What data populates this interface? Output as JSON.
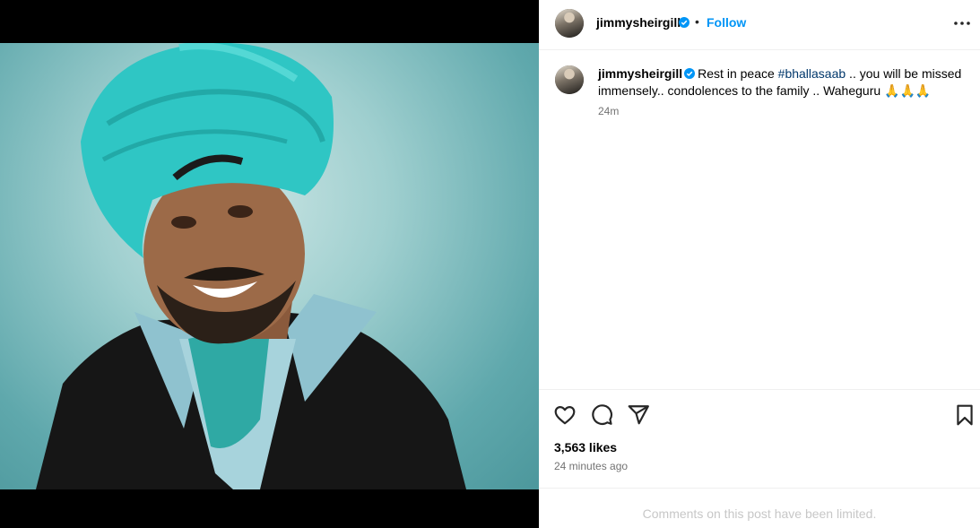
{
  "post": {
    "username": "jimmysheirgill",
    "follow_label": "Follow",
    "dot": "•",
    "caption": {
      "text_1": "Rest in peace ",
      "hashtag": "#bhallasaab",
      "text_2": " .. you will be missed immensely.. condolences to the family .. Waheguru 🙏🙏🙏",
      "time": "24m"
    },
    "likes": "3,563 likes",
    "posted": "24 minutes ago",
    "comments_notice": "Comments on this post have been limited."
  },
  "icons": {
    "verified": "verified-badge-icon",
    "more": "more-options-icon",
    "like": "heart-icon",
    "comment": "comment-bubble-icon",
    "share": "paper-plane-icon",
    "save": "bookmark-icon"
  },
  "colors": {
    "accent": "#0095f6",
    "hashtag": "#00376b",
    "muted": "#737373",
    "notice": "#c7c7c7",
    "turban": "#2fc6c4"
  }
}
